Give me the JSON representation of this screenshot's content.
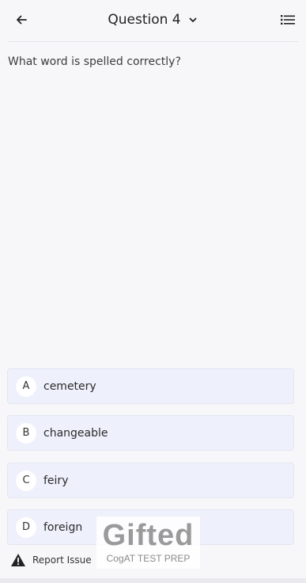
{
  "header": {
    "title": "Question 4",
    "back_icon": "arrow-left-icon",
    "dropdown_icon": "chevron-down-icon",
    "list_icon": "list-icon"
  },
  "question": {
    "text": "What word is spelled correctly?"
  },
  "options": [
    {
      "letter": "A",
      "label": "cemetery"
    },
    {
      "letter": "B",
      "label": "changeable"
    },
    {
      "letter": "C",
      "label": "feiry"
    },
    {
      "letter": "D",
      "label": "foreign"
    }
  ],
  "footer": {
    "report_label": "Report Issue",
    "report_icon": "warning-icon"
  },
  "watermark": {
    "word": "Gifted",
    "subtitle": "CogAT TEST PREP"
  },
  "colors": {
    "background": "#f7f7fa",
    "option_bg": "#eef0fb",
    "text": "#2b2b2b"
  }
}
